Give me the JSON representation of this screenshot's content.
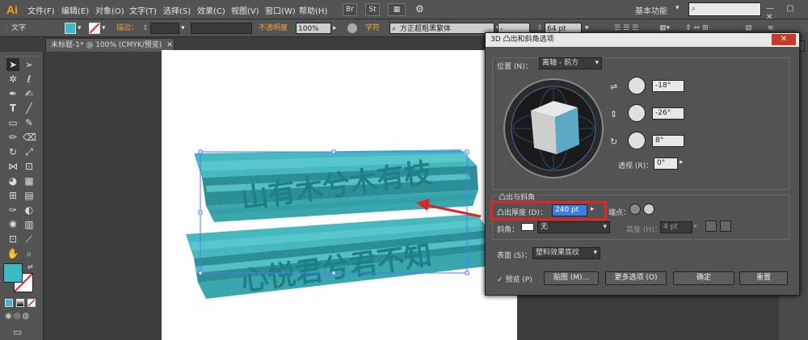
{
  "app": {
    "logo": "Ai"
  },
  "menu": [
    "文件(F)",
    "编辑(E)",
    "对象(O)",
    "文字(T)",
    "选择(S)",
    "效果(C)",
    "视图(V)",
    "窗口(W)",
    "帮助(H)"
  ],
  "menu_buttons": {
    "br": "Br",
    "st": "St"
  },
  "workspace": "基本功能",
  "search": {
    "placeholder": ""
  },
  "window_controls": "— ▢ ✕",
  "control_bar": {
    "tool_label": "文字",
    "stroke_label": "描边：",
    "opacity_label": "不透明度",
    "opacity_value": "100%",
    "char_label": "字符",
    "font_value": "方正超粗黑繁体",
    "style_value": "-",
    "size_value": "64 pt"
  },
  "doc_tab": "未标题-1* @ 100% (CMYK/预览)",
  "canvas_text": {
    "line1": "山有木兮木有枝",
    "line2": "心悦君兮君不知"
  },
  "dialog": {
    "title": "3D 凸出和斜角选项",
    "position_label": "位置 (N)：",
    "position_value": "离轴 - 前方",
    "rot_x": "-18°",
    "rot_y": "-26°",
    "rot_z": "8°",
    "perspective_label": "透视 (R)：",
    "perspective_value": "0°",
    "extrude_group": "凸出与斜角",
    "extrude_depth_label": "凸出厚度 (D)：",
    "extrude_depth_value": "240 pt",
    "cap_label": "端点：",
    "bevel_label": "斜角：",
    "bevel_value": "无",
    "height_label": "高度 (H)：",
    "height_value": "4 pt",
    "surface_label": "表面 (S)：",
    "surface_value": "塑料效果底纹",
    "preview_label": "预览 (P)",
    "map_button": "贴图 (M)...",
    "more_button": "更多选项 (O)",
    "ok_button": "确定",
    "cancel_button": "重置"
  },
  "colors": {
    "fill": "#3cb9c2",
    "accent_red": "#e02424",
    "cube_front": "#5aa9c6",
    "cube_side": "#cfcfcf"
  }
}
